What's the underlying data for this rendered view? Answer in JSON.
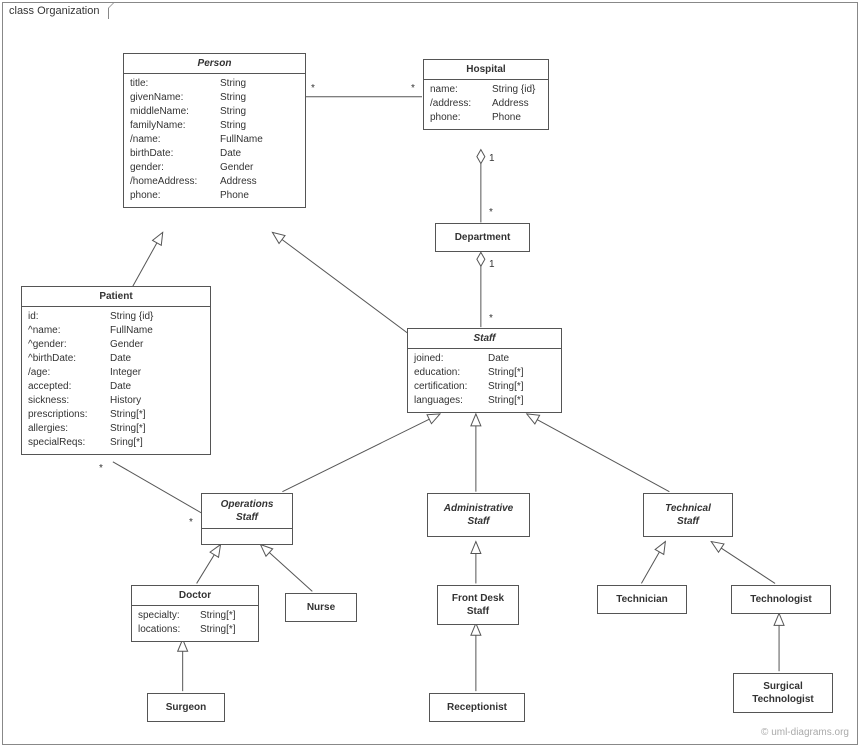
{
  "frame": {
    "label": "class Organization"
  },
  "classes": {
    "person": {
      "name": "Person",
      "attrs": [
        {
          "k": "title:",
          "v": "String"
        },
        {
          "k": "givenName:",
          "v": "String"
        },
        {
          "k": "middleName:",
          "v": "String"
        },
        {
          "k": "familyName:",
          "v": "String"
        },
        {
          "k": "/name:",
          "v": "FullName"
        },
        {
          "k": "birthDate:",
          "v": "Date"
        },
        {
          "k": "gender:",
          "v": "Gender"
        },
        {
          "k": "/homeAddress:",
          "v": "Address"
        },
        {
          "k": "phone:",
          "v": "Phone"
        }
      ]
    },
    "hospital": {
      "name": "Hospital",
      "attrs": [
        {
          "k": "name:",
          "v": "String {id}"
        },
        {
          "k": "/address:",
          "v": "Address"
        },
        {
          "k": "phone:",
          "v": "Phone"
        }
      ]
    },
    "department": {
      "name": "Department"
    },
    "patient": {
      "name": "Patient",
      "attrs": [
        {
          "k": "id:",
          "v": "String {id}"
        },
        {
          "k": "^name:",
          "v": "FullName"
        },
        {
          "k": "^gender:",
          "v": "Gender"
        },
        {
          "k": "^birthDate:",
          "v": "Date"
        },
        {
          "k": "/age:",
          "v": "Integer"
        },
        {
          "k": "accepted:",
          "v": "Date"
        },
        {
          "k": "sickness:",
          "v": "History"
        },
        {
          "k": "prescriptions:",
          "v": "String[*]"
        },
        {
          "k": "allergies:",
          "v": "String[*]"
        },
        {
          "k": "specialReqs:",
          "v": "Sring[*]"
        }
      ]
    },
    "staff": {
      "name": "Staff",
      "attrs": [
        {
          "k": "joined:",
          "v": "Date"
        },
        {
          "k": "education:",
          "v": "String[*]"
        },
        {
          "k": "certification:",
          "v": "String[*]"
        },
        {
          "k": "languages:",
          "v": "String[*]"
        }
      ]
    },
    "opsStaff": {
      "name1": "Operations",
      "name2": "Staff",
      "attrs": []
    },
    "adminStaff": {
      "name1": "Administrative",
      "name2": "Staff"
    },
    "techStaff": {
      "name1": "Technical",
      "name2": "Staff"
    },
    "doctor": {
      "name": "Doctor",
      "attrs": [
        {
          "k": "specialty:",
          "v": "String[*]"
        },
        {
          "k": "locations:",
          "v": "String[*]"
        }
      ]
    },
    "nurse": {
      "name": "Nurse"
    },
    "frontDesk": {
      "name1": "Front Desk",
      "name2": "Staff"
    },
    "receptionist": {
      "name": "Receptionist"
    },
    "technician": {
      "name": "Technician"
    },
    "technologist": {
      "name": "Technologist"
    },
    "surgTech": {
      "name1": "Surgical",
      "name2": "Technologist"
    },
    "surgeon": {
      "name": "Surgeon"
    }
  },
  "multiplicities": {
    "m1": "*",
    "m2": "*",
    "m3": "1",
    "m4": "*",
    "m5": "1",
    "m6": "*",
    "m7": "*",
    "m8": "*"
  },
  "watermark": "© uml-diagrams.org"
}
